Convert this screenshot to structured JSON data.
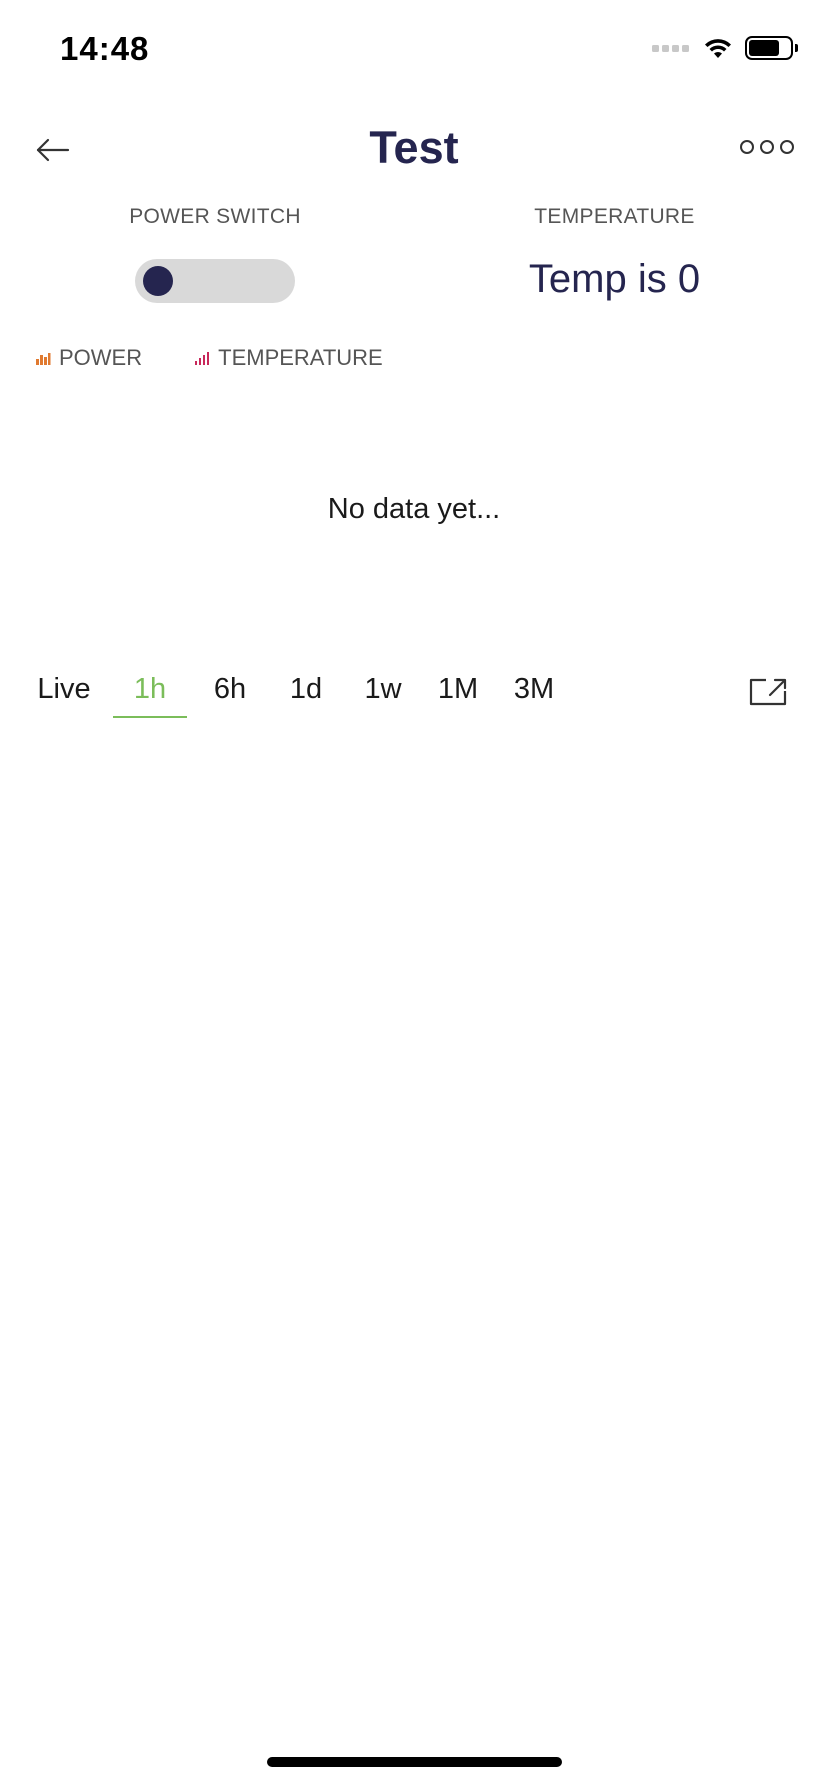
{
  "status_bar": {
    "time": "14:48"
  },
  "header": {
    "title": "Test"
  },
  "widgets": {
    "power": {
      "label": "POWER SWITCH",
      "state": "off"
    },
    "temperature": {
      "label": "TEMPERATURE",
      "value": "Temp is 0"
    }
  },
  "legend": {
    "items": [
      {
        "label": "POWER",
        "color": "#e07a30",
        "icon": "bar-chart-icon"
      },
      {
        "label": "TEMPERATURE",
        "color": "#c8285a",
        "icon": "bar-chart-icon"
      }
    ]
  },
  "chart": {
    "empty_message": "No data yet..."
  },
  "range_tabs": {
    "items": [
      "Live",
      "1h",
      "6h",
      "1d",
      "1w",
      "1M",
      "3M"
    ],
    "selected": "1h"
  },
  "colors": {
    "accent": "#25254f",
    "active_tab": "#7bbd5a"
  }
}
